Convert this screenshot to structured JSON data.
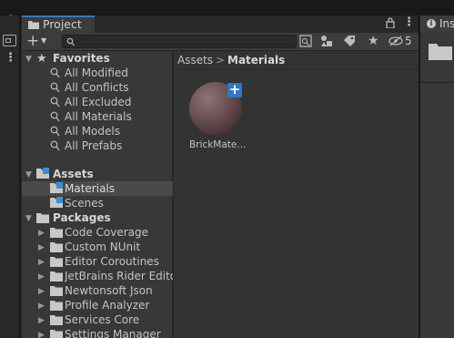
{
  "window": {
    "tab_title": "Project",
    "inspector_tab_title": "Ins",
    "hidden_count": "5",
    "search_placeholder": ""
  },
  "favorites": {
    "label": "Favorites",
    "items": [
      {
        "label": "All Modified"
      },
      {
        "label": "All Conflicts"
      },
      {
        "label": "All Excluded"
      },
      {
        "label": "All Materials"
      },
      {
        "label": "All Models"
      },
      {
        "label": "All Prefabs"
      }
    ]
  },
  "assets": {
    "label": "Assets",
    "items": [
      {
        "label": "Materials",
        "selected": true
      },
      {
        "label": "Scenes",
        "selected": false
      }
    ]
  },
  "packages": {
    "label": "Packages",
    "items": [
      {
        "label": "Code Coverage"
      },
      {
        "label": "Custom NUnit"
      },
      {
        "label": "Editor Coroutines"
      },
      {
        "label": "JetBrains Rider Editor"
      },
      {
        "label": "Newtonsoft Json"
      },
      {
        "label": "Profile Analyzer"
      },
      {
        "label": "Services Core"
      },
      {
        "label": "Settings Manager"
      }
    ]
  },
  "breadcrumb": {
    "root": "Assets",
    "separator": ">",
    "current": "Materials"
  },
  "content": {
    "items": [
      {
        "label": "BrickMate..."
      }
    ]
  },
  "colors": {
    "accent": "#3a79bb",
    "panel": "#383838",
    "content": "#333333",
    "selection": "#4a4a4a"
  }
}
